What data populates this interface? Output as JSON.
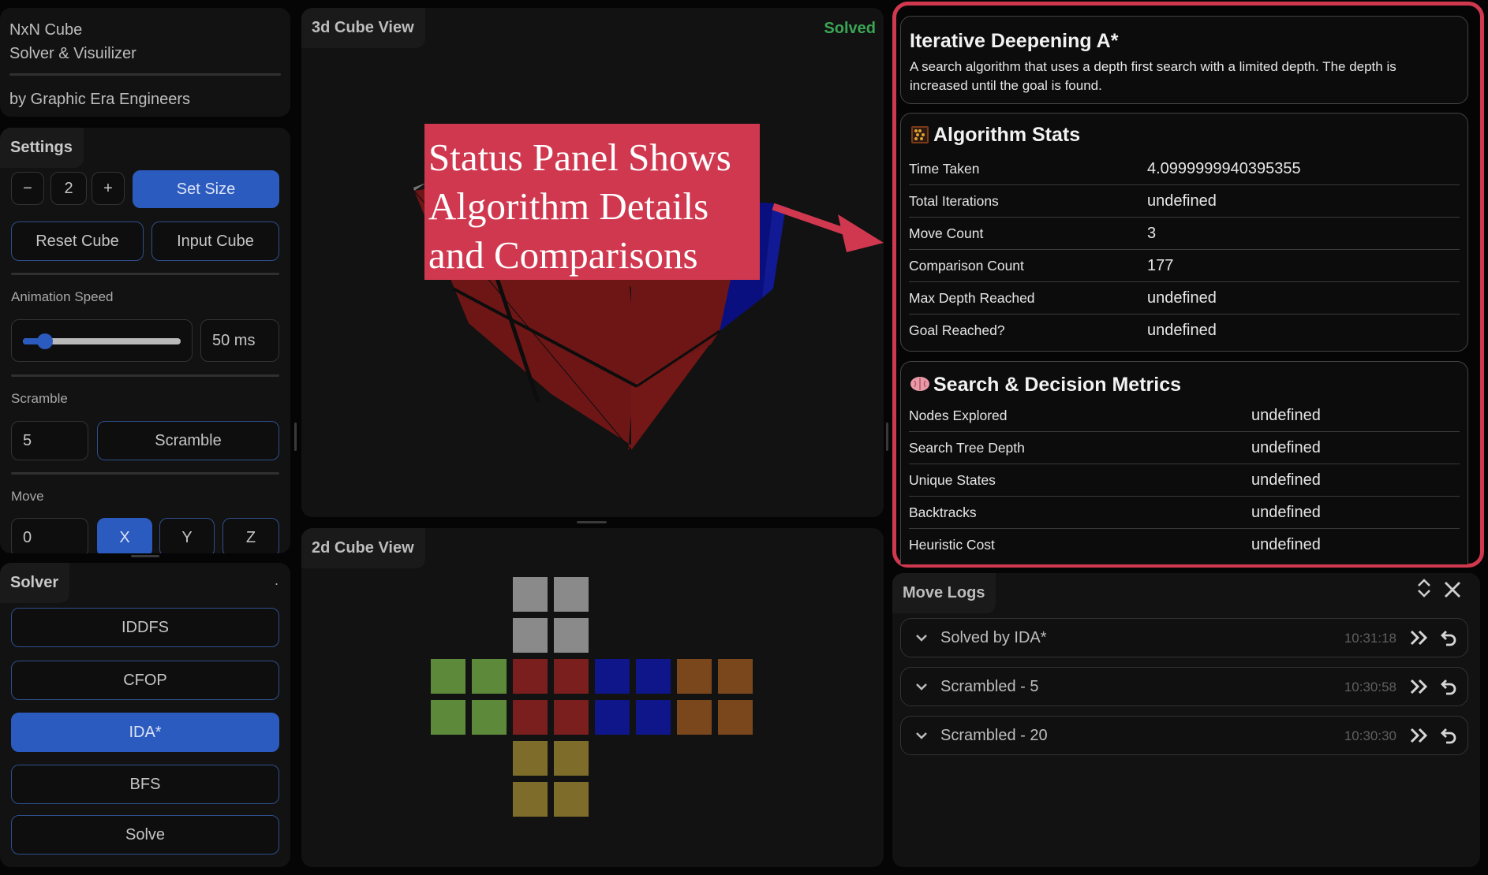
{
  "brand": {
    "title_line1": "NxN Cube",
    "title_line2": "Solver & Visuilizer",
    "credit": "by Graphic Era Engineers"
  },
  "settings": {
    "heading": "Settings",
    "size_minus": "−",
    "size_value": "2",
    "size_plus": "+",
    "set_size_label": "Set Size",
    "reset_label": "Reset Cube",
    "input_label": "Input Cube",
    "animation_speed_label": "Animation Speed",
    "animation_speed_value": "50 ms",
    "animation_speed_fraction": 0.12,
    "scramble_label": "Scramble",
    "scramble_count": "5",
    "scramble_button": "Scramble",
    "move_label": "Move",
    "move_value": "0",
    "axis_options": [
      "X",
      "Y",
      "Z"
    ],
    "axis_selected": "X"
  },
  "solver": {
    "heading": "Solver",
    "dot": ".",
    "buttons": [
      "IDDFS",
      "CFOP",
      "IDA*",
      "BFS",
      "Solve"
    ],
    "selected": "IDA*"
  },
  "view3d": {
    "title": "3d Cube View",
    "status": "Solved"
  },
  "view2d": {
    "title": "2d Cube View"
  },
  "annotation": {
    "line1": "Status Panel Shows",
    "line2": "Algorithm Details",
    "line3": "and Comparisons"
  },
  "algorithm": {
    "name": "Iterative Deepening A*",
    "description": "A search algorithm that uses a depth first search with a limited depth. The depth is increased until the goal is found."
  },
  "stats": {
    "heading": "Algorithm Stats",
    "icon": "abacus-icon",
    "rows": [
      {
        "label": "Time Taken",
        "value": "4.0999999940395355"
      },
      {
        "label": "Total Iterations",
        "value": "undefined"
      },
      {
        "label": "Move Count",
        "value": "3"
      },
      {
        "label": "Comparison Count",
        "value": "177"
      },
      {
        "label": "Max Depth Reached",
        "value": "undefined"
      },
      {
        "label": "Goal Reached?",
        "value": "undefined"
      }
    ]
  },
  "metrics": {
    "heading": "Search & Decision Metrics",
    "icon": "brain-icon",
    "rows": [
      {
        "label": "Nodes Explored",
        "value": "undefined"
      },
      {
        "label": "Search Tree Depth",
        "value": "undefined"
      },
      {
        "label": "Unique States",
        "value": "undefined"
      },
      {
        "label": "Backtracks",
        "value": "undefined"
      },
      {
        "label": "Heuristic Cost",
        "value": "undefined"
      }
    ]
  },
  "move_logs": {
    "heading": "Move Logs",
    "entries": [
      {
        "title": "Solved by IDA*",
        "time": "10:31:18"
      },
      {
        "title": "Scrambled - 5",
        "time": "10:30:58"
      },
      {
        "title": "Scrambled - 20",
        "time": "10:30:30"
      }
    ]
  },
  "colors": {
    "accent": "#2c5bbf",
    "solved": "#3aa655",
    "highlight": "#d0384f",
    "white": "#8a8a8a",
    "green": "#5d8a3a",
    "red": "#7a1e1e",
    "blue": "#0e168a",
    "orange": "#7a471d",
    "yellow": "#7d6c2a"
  }
}
